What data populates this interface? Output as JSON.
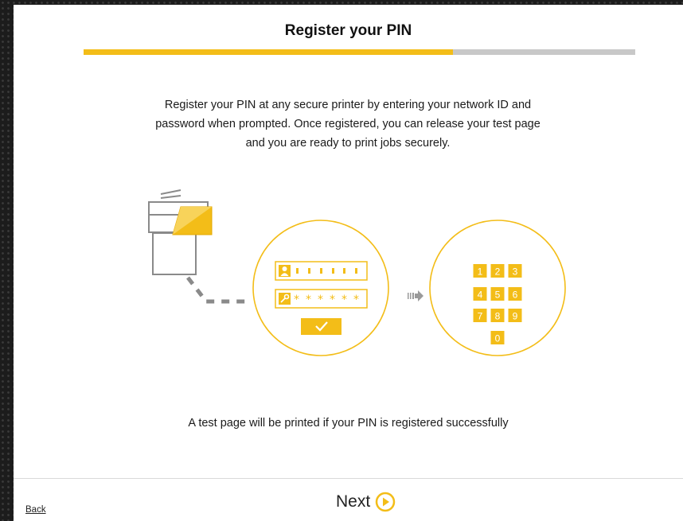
{
  "header": {
    "title": "Register your PIN"
  },
  "progress": {
    "fraction": 0.67
  },
  "main": {
    "description": "Register your PIN at any secure printer by entering your network ID and password when prompted. Once registered, you can release your test page and you are ready to print jobs securely.",
    "footnote": "A test page will be printed if your PIN is registered successfully"
  },
  "keypad": {
    "keys": [
      "1",
      "2",
      "3",
      "4",
      "5",
      "6",
      "7",
      "8",
      "9",
      "0"
    ]
  },
  "footer": {
    "back_label": "Back",
    "next_label": "Next"
  },
  "colors": {
    "accent": "#f3bd18",
    "track": "#c8c8c8",
    "icon_gray": "#8a8a8a"
  },
  "icons": [
    "printer-icon",
    "user-icon",
    "key-icon",
    "checkmark-icon",
    "arrow-right-icon",
    "play-circle-icon"
  ]
}
